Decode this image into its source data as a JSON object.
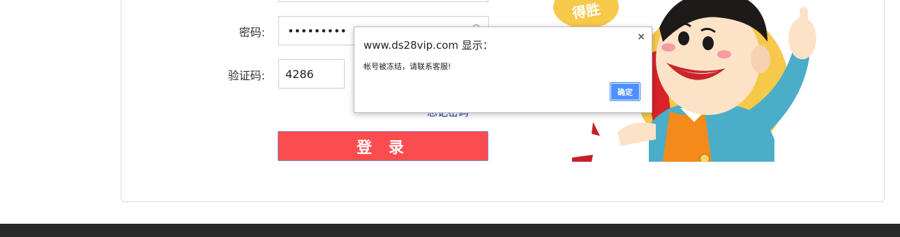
{
  "form": {
    "password_label": "密码:",
    "password_value": "•••••••••",
    "captcha_label": "验证码:",
    "captcha_value": "4286",
    "login_button": "登 录",
    "forgot_link_fragment": "忘记密码"
  },
  "illustration": {
    "badge_text": "得胜"
  },
  "dialog": {
    "title": "www.ds28vip.com 显示：",
    "message": "帐号被冻结，请联系客服!",
    "ok_button": "确定",
    "close_symbol": "×"
  }
}
